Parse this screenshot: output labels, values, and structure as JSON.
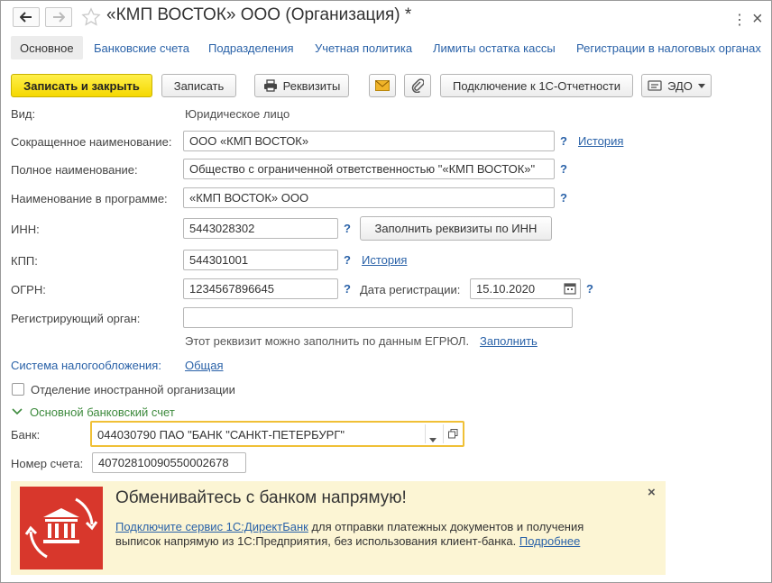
{
  "window": {
    "title": "«КМП ВОСТОК» ООО (Организация) *",
    "more_icon": "⋮",
    "close_icon": "×"
  },
  "tabs": [
    {
      "label": "Основное"
    },
    {
      "label": "Банковские счета"
    },
    {
      "label": "Подразделения"
    },
    {
      "label": "Учетная политика"
    },
    {
      "label": "Лимиты остатка кассы"
    },
    {
      "label": "Регистрации в налоговых органах"
    }
  ],
  "toolbar": {
    "save_close": "Записать и закрыть",
    "save": "Записать",
    "requisites": "Реквизиты",
    "connect_reporting": "Подключение к 1С-Отчетности",
    "edo": "ЭДО"
  },
  "form": {
    "type_label": "Вид:",
    "type_value": "Юридическое лицо",
    "short_name_label": "Сокращенное наименование:",
    "short_name_value": "ООО «КМП ВОСТОК»",
    "full_name_label": "Полное наименование:",
    "full_name_value": "Общество с ограниченной ответственностью \"«КМП ВОСТОК»\"",
    "program_name_label": "Наименование в программе:",
    "program_name_value": "«КМП ВОСТОК» ООО",
    "inn_label": "ИНН:",
    "inn_value": "5443028302",
    "fill_by_inn": "Заполнить реквизиты по ИНН",
    "kpp_label": "КПП:",
    "kpp_value": "544301001",
    "ogrn_label": "ОГРН:",
    "ogrn_value": "1234567896645",
    "reg_date_label": "Дата регистрации:",
    "reg_date_value": "15.10.2020",
    "reg_authority_label": "Регистрирующий орган:",
    "reg_authority_value": "",
    "egrul_hint": "Этот реквизит можно заполнить по данным ЕГРЮЛ.",
    "fill_link": "Заполнить",
    "history_link": "История",
    "question": "?",
    "tax_system_label": "Система налогообложения:",
    "tax_system_value": "Общая",
    "foreign_branch_label": "Отделение иностранной организации",
    "bank_section_label": "Основной банковский счет",
    "bank_label": "Банк:",
    "bank_value": "044030790 ПАО \"БАНК \"САНКТ-ПЕТЕРБУРГ\"",
    "account_label": "Номер счета:",
    "account_value": "40702810090550002678"
  },
  "banner": {
    "title": "Обменивайтесь с банком напрямую!",
    "link1": "Подключите сервис 1С:ДиректБанк",
    "text": " для отправки платежных документов и получения выписок напрямую из 1С:Предприятия, без использования клиент-банка. ",
    "link2": "Подробнее",
    "close_icon": "×"
  },
  "colors": {
    "accent_link": "#2a62a8",
    "primary_button": "#f5d800",
    "focus_border": "#f0c036",
    "section_green": "#3d8a3d",
    "banner_bg": "#fcf5d4",
    "banner_logo": "#d8372c"
  }
}
